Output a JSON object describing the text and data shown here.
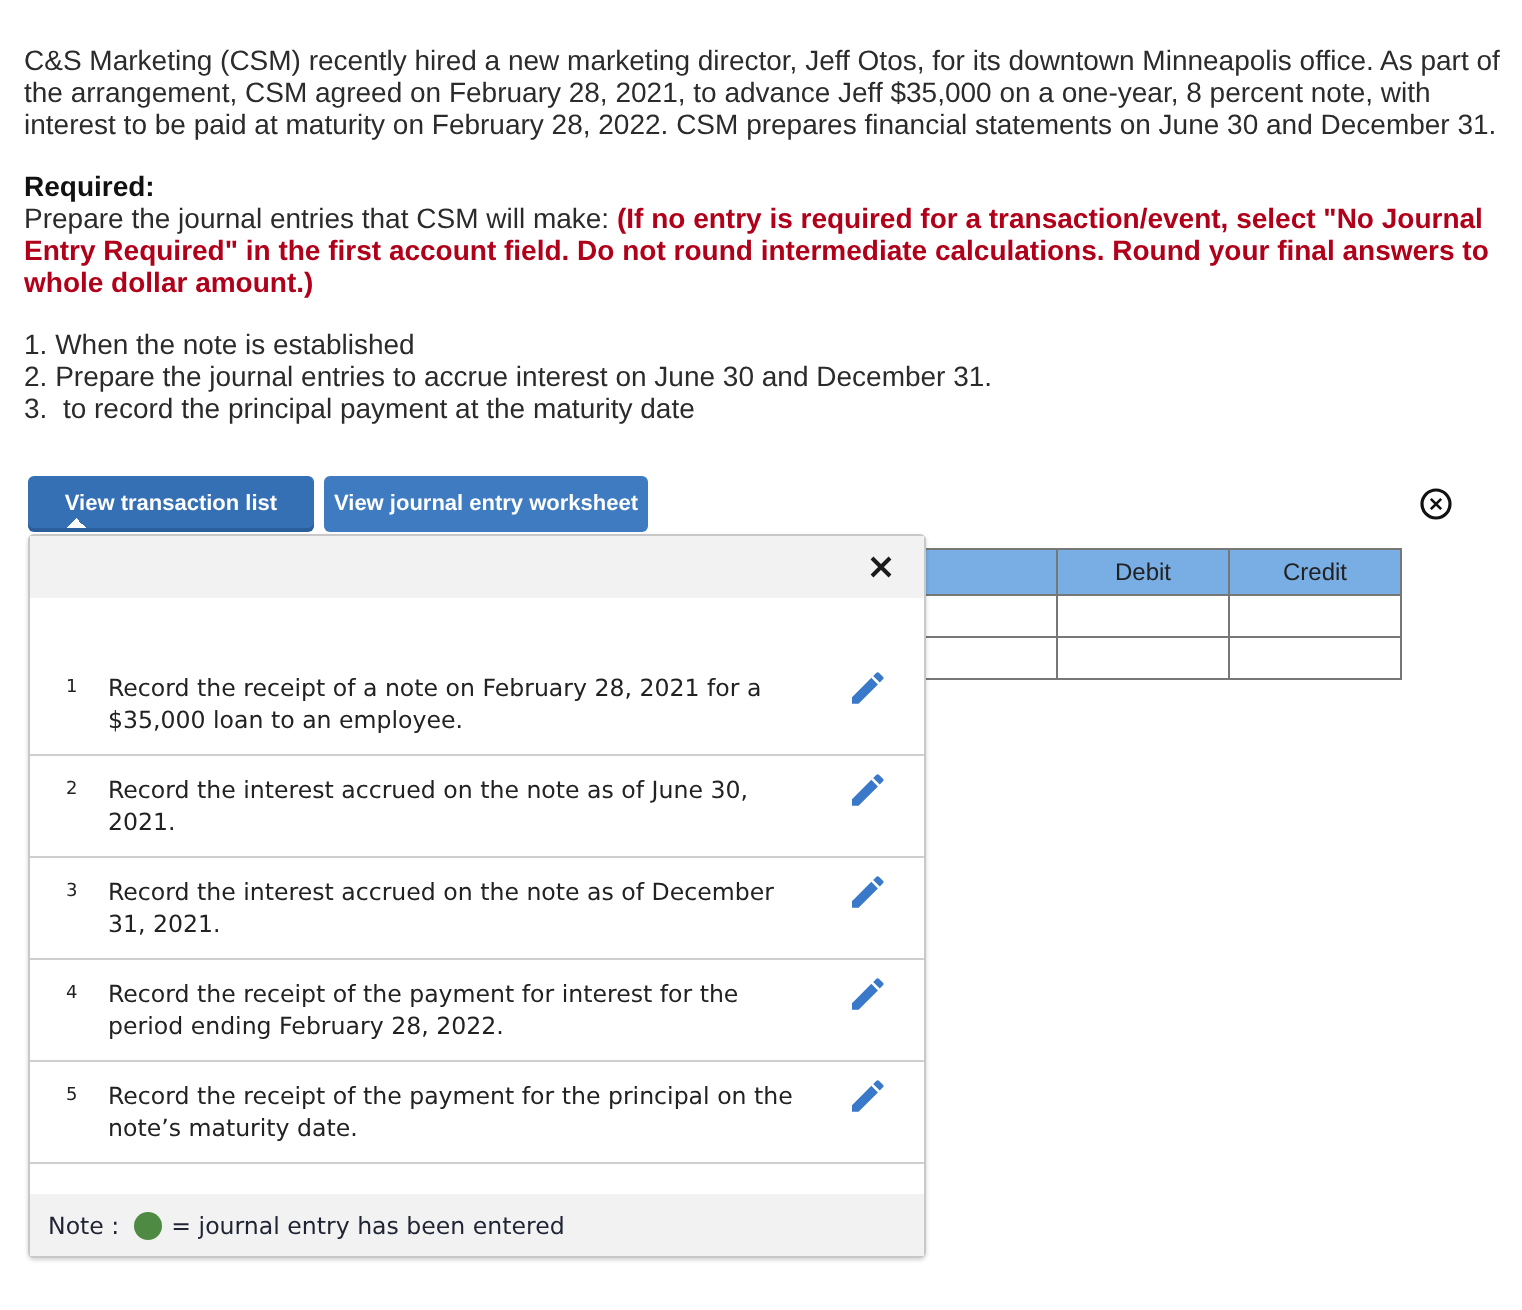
{
  "problem": {
    "paragraph": "C&S Marketing (CSM) recently hired a new marketing director, Jeff Otos, for its downtown Minneapolis office. As part of the arrangement, CSM agreed on February 28, 2021, to advance Jeff $35,000 on a one-year, 8 percent note, with interest to be paid at maturity on February 28, 2022. CSM prepares financial statements on June 30 and December 31.",
    "required_heading": "Required:",
    "instruction": "Prepare the journal entries that CSM will make: **(If no entry is required for a transaction/event, select \"No Journal Entry Required\" in the first account field. Do not round intermediate calculations. Round your final answers to whole dollar amount.)**",
    "steps": [
      "1. When the note is established",
      "2. Prepare the journal entries to accrue interest on June 30 and December 31.",
      "3.  to record the principal payment at the maturity date"
    ]
  },
  "tabs": [
    {
      "label": "View transaction list",
      "selected": true
    },
    {
      "label": "View journal entry worksheet",
      "selected": false
    }
  ],
  "transaction_list": {
    "transactions": [
      {
        "number": "1",
        "description": "Record the receipt of a note on February 28, 2021 for a $35,000 loan to an employee."
      },
      {
        "number": "2",
        "description": "Record the interest accrued on the note as of June 30, 2021."
      },
      {
        "number": "3",
        "description": "Record the interest accrued on the note as of December 31, 2021."
      },
      {
        "number": "4",
        "description": "Record the receipt of the payment for interest for the period ending February 28, 2022."
      },
      {
        "number": "5",
        "description": "Record the receipt of the payment for the principal on the note’s maturity date."
      }
    ],
    "note": {
      "label": "Note :",
      "text": "= journal entry has been entered"
    }
  },
  "journal_table": {
    "columns": [
      "Debit",
      "Credit"
    ]
  }
}
